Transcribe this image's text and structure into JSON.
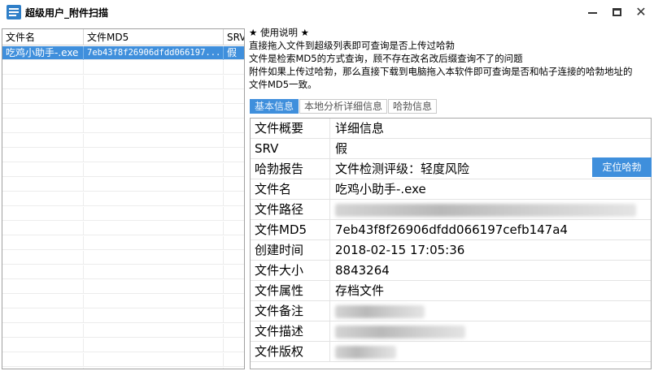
{
  "window": {
    "title": "超级用户_附件扫描",
    "icon": "app-logo-icon",
    "controls": [
      "minimize-icon",
      "maximize-icon",
      "close-icon"
    ]
  },
  "file_table": {
    "columns": [
      "文件名",
      "文件MD5",
      "SRV"
    ],
    "rows": [
      {
        "name": "吃鸡小助手-.exe",
        "md5": "7eb43f8f26906dfdd066197...",
        "srv": "假",
        "selected": true
      }
    ]
  },
  "instructions": {
    "heading": "★ 使用说明 ★",
    "lines": [
      "直接拖入文件到超级列表即可查询是否上传过哈勃",
      "文件是检索MD5的方式查询，顾不存在改名改后缀查询不了的问题",
      "附件如果上传过哈勃，那么直接下载到电脑拖入本软件即可查询是否和帖子连接的哈勃地址的",
      "文件MD5一致。"
    ]
  },
  "tabs": [
    {
      "label": "基本信息",
      "active": true
    },
    {
      "label": "本地分析详细信息",
      "active": false
    },
    {
      "label": "哈勃信息",
      "active": false
    }
  ],
  "details": {
    "header": {
      "key": "文件概要",
      "value": "详细信息"
    },
    "rows": [
      {
        "key": "SRV",
        "value": "假"
      },
      {
        "key": "哈勃报告",
        "value": "文件检测评级：轻度风险"
      },
      {
        "key": "文件名",
        "value": "吃鸡小助手-.exe"
      },
      {
        "key": "文件路径",
        "value": ""
      },
      {
        "key": "文件MD5",
        "value": "7eb43f8f26906dfdd066197cefb147a4"
      },
      {
        "key": "创建时间",
        "value": "2018-02-15 17:05:36"
      },
      {
        "key": "文件大小",
        "value": "8843264"
      },
      {
        "key": "文件属性",
        "value": "存档文件"
      },
      {
        "key": "文件备注",
        "value": ""
      },
      {
        "key": "文件描述",
        "value": ""
      },
      {
        "key": "文件版权",
        "value": ""
      }
    ]
  },
  "locate_button": {
    "label": "定位哈勃"
  },
  "colors": {
    "accent": "#3f8fdc",
    "icon_blue": "#2f7fc8"
  }
}
